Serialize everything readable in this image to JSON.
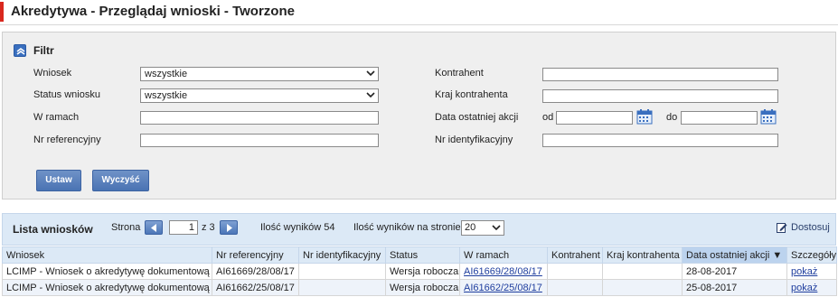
{
  "page": {
    "title": "Akredytywa - Przeglądaj wnioski - Tworzone"
  },
  "filter": {
    "title": "Filtr",
    "wniosek": {
      "label": "Wniosek",
      "value": "wszystkie"
    },
    "status": {
      "label": "Status wniosku",
      "value": "wszystkie"
    },
    "w_ramach": {
      "label": "W ramach",
      "value": ""
    },
    "nr_ref": {
      "label": "Nr referencyjny",
      "value": ""
    },
    "kontrahent": {
      "label": "Kontrahent",
      "value": ""
    },
    "kraj": {
      "label": "Kraj kontrahenta",
      "value": ""
    },
    "data": {
      "label": "Data ostatniej akcji",
      "od_label": "od",
      "do_label": "do",
      "od_value": "",
      "do_value": ""
    },
    "nr_id": {
      "label": "Nr identyfikacyjny",
      "value": ""
    },
    "set_button": "Ustaw",
    "clear_button": "Wyczyść"
  },
  "results": {
    "title": "Lista wniosków",
    "page_label": "Strona",
    "page_value": "1",
    "page_total": "z 3",
    "count_text": "Ilość wyników 54",
    "per_page_label": "Ilość wyników na stronie",
    "per_page_value": "20",
    "customize_label": "Dostosuj"
  },
  "table": {
    "columns": [
      "Wniosek",
      "Nr referencyjny",
      "Nr identyfikacyjny",
      "Status",
      "W ramach",
      "Kontrahent",
      "Kraj kontrahenta",
      "Data ostatniej akcji ▼",
      "Szczegóły"
    ],
    "rows": [
      [
        "LCIMP - Wniosek o akredytywę dokumentową",
        "AI61669/28/08/17",
        "",
        "Wersja robocza",
        "AI61669/28/08/17",
        "",
        "",
        "28-08-2017",
        "pokaż"
      ],
      [
        "LCIMP - Wniosek o akredytywę dokumentową",
        "AI61662/25/08/17",
        "",
        "Wersja robocza",
        "AI61662/25/08/17",
        "",
        "",
        "25-08-2017",
        "pokaż"
      ]
    ]
  },
  "colors": {
    "accent": "#d9281e",
    "button": "#4a73b3",
    "header_bg": "#dce9f6"
  },
  "icons": [
    "collapse-up-icon",
    "calendar-icon",
    "chevron-down-icon",
    "arrow-left-icon",
    "arrow-right-icon",
    "edit-icon"
  ]
}
